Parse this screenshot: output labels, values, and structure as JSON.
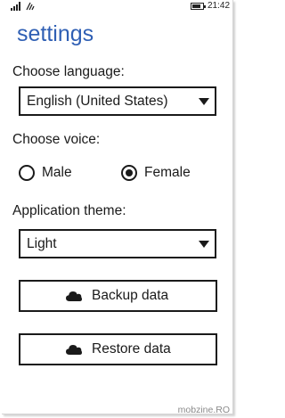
{
  "status_bar": {
    "time": "21:42",
    "icons": [
      "signal-icon",
      "wifi-icon",
      "battery-icon"
    ]
  },
  "page": {
    "title": "settings"
  },
  "language": {
    "label": "Choose language:",
    "selected": "English (United States)"
  },
  "voice": {
    "label": "Choose voice:",
    "options": [
      {
        "label": "Male",
        "selected": false
      },
      {
        "label": "Female",
        "selected": true
      }
    ]
  },
  "theme": {
    "label": "Application theme:",
    "selected": "Light"
  },
  "buttons": {
    "backup_label": "Backup data",
    "restore_label": "Restore data",
    "icon": "cloud-icon"
  },
  "watermark": "mobzine.RO",
  "colors": {
    "accent": "#2f5fb4",
    "foreground": "#1a1a1a",
    "background": "#ffffff"
  }
}
